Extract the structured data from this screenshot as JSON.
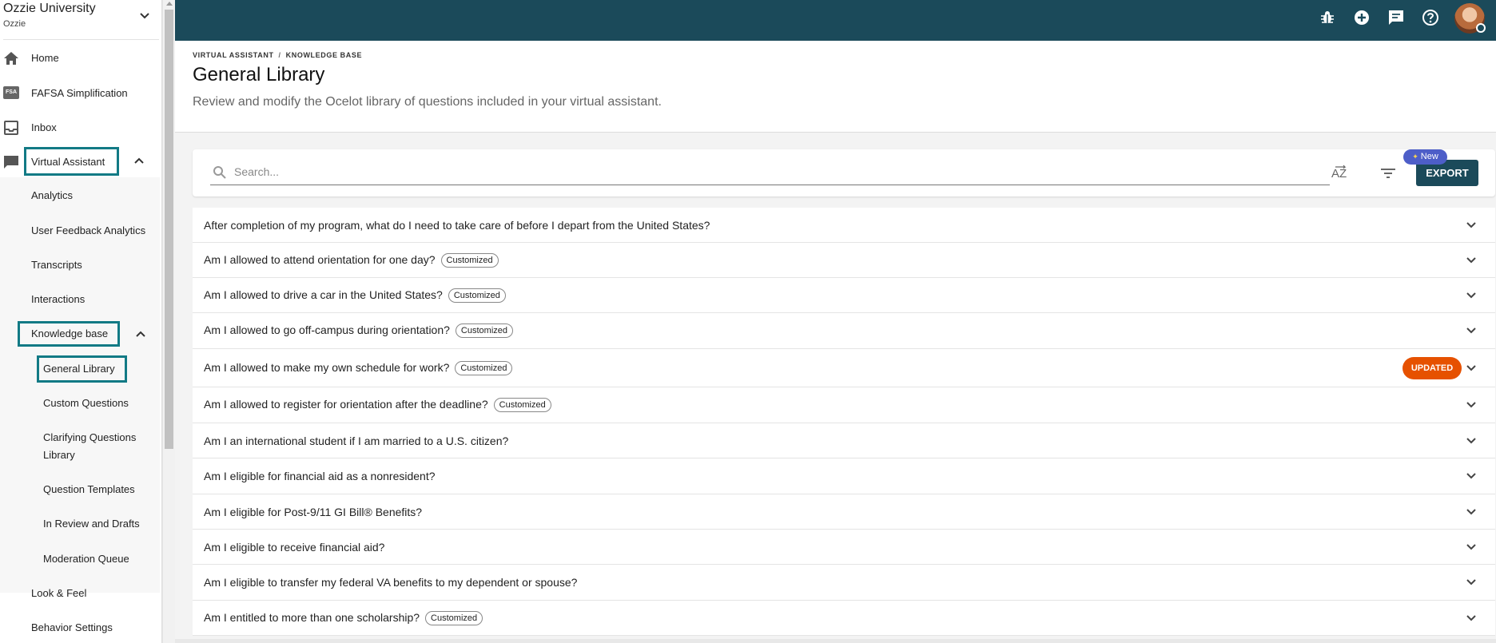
{
  "sidebar": {
    "org_name": "Ozzie University",
    "org_sub": "Ozzie",
    "nav": {
      "home": "Home",
      "fafsa": "FAFSA Simplification",
      "fafsa_icon_text": "FSA",
      "inbox": "Inbox",
      "virtual_assistant": "Virtual Assistant",
      "analytics": "Analytics",
      "user_feedback": "User Feedback Analytics",
      "transcripts": "Transcripts",
      "interactions": "Interactions",
      "knowledge_base": "Knowledge base",
      "general_library": "General Library",
      "custom_questions": "Custom Questions",
      "clarifying_1": "Clarifying Questions",
      "clarifying_2": "Library",
      "question_templates": "Question Templates",
      "in_review": "In Review and Drafts",
      "moderation": "Moderation Queue",
      "look_feel": "Look & Feel",
      "behavior": "Behavior Settings"
    }
  },
  "header": {
    "breadcrumb_1": "VIRTUAL ASSISTANT",
    "breadcrumb_sep": "/",
    "breadcrumb_2": "KNOWLEDGE BASE",
    "title": "General Library",
    "description": "Review and modify the Ocelot library of questions included in your virtual assistant."
  },
  "toolbar": {
    "search_placeholder": "Search...",
    "export_label": "EXPORT",
    "new_badge": "New",
    "sort_label": "AZ"
  },
  "questions": [
    {
      "text": "After completion of my program, what do I need to take care of before I depart from the United States?",
      "tag": "",
      "status": ""
    },
    {
      "text": "Am I allowed to attend orientation for one day?",
      "tag": "Customized",
      "status": ""
    },
    {
      "text": "Am I allowed to drive a car in the United States?",
      "tag": "Customized",
      "status": ""
    },
    {
      "text": "Am I allowed to go off-campus during orientation?",
      "tag": "Customized",
      "status": ""
    },
    {
      "text": "Am I allowed to make my own schedule for work?",
      "tag": "Customized",
      "status": "UPDATED"
    },
    {
      "text": "Am I allowed to register for orientation after the deadline?",
      "tag": "Customized",
      "status": ""
    },
    {
      "text": "Am I an international student if I am married to a U.S. citizen?",
      "tag": "",
      "status": ""
    },
    {
      "text": "Am I eligible for financial aid as a nonresident?",
      "tag": "",
      "status": ""
    },
    {
      "text": "Am I eligible for Post-9/11 GI Bill® Benefits?",
      "tag": "",
      "status": ""
    },
    {
      "text": "Am I eligible to receive financial aid?",
      "tag": "",
      "status": ""
    },
    {
      "text": "Am I eligible to transfer my federal VA benefits to my dependent or spouse?",
      "tag": "",
      "status": ""
    },
    {
      "text": "Am I entitled to more than one scholarship?",
      "tag": "Customized",
      "status": ""
    }
  ],
  "colors": {
    "topbar": "#1b4a5a",
    "highlight": "#127a85",
    "updated": "#e65100",
    "new_badge": "#4d5ec8"
  },
  "icons": [
    "home-icon",
    "fsa-icon",
    "inbox-icon",
    "chat-icon",
    "bug-icon",
    "add-circle-icon",
    "message-icon",
    "help-icon",
    "search-icon",
    "sort-az-icon",
    "filter-icon",
    "chevron-down-icon",
    "chevron-up-icon"
  ]
}
